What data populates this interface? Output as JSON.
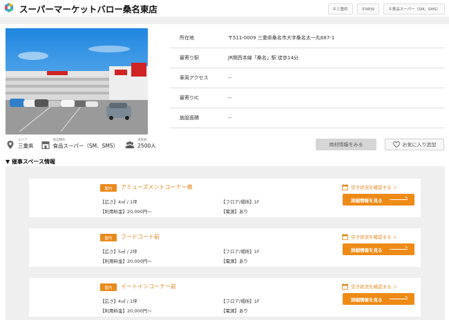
{
  "header": {
    "title": "スーパーマーケットバロー桑名東店",
    "tags": [
      "＃三重県",
      "＃NEW",
      "＃食品スーパー（SM、SMS）"
    ]
  },
  "info": [
    {
      "key": "所在地",
      "value": "〒511-0009 三重県桑名市大字桑名太一丸687-1"
    },
    {
      "key": "最寄り駅",
      "value": "JR関西本線「桑名」駅 徒歩14分"
    },
    {
      "key": "車両アクセス",
      "value": "--"
    },
    {
      "key": "最寄りIC",
      "value": "--"
    },
    {
      "key": "施設面積",
      "value": "--"
    }
  ],
  "stats": [
    {
      "label": "エリア",
      "value": "三重県",
      "icon": "location-pin-icon"
    },
    {
      "label": "施設種別",
      "value": "食品スーパー（SM、SMS）",
      "icon": "store-icon"
    },
    {
      "label": "来客数",
      "value": "2500人",
      "icon": "people-icon"
    }
  ],
  "actions": {
    "commerce": "商材情報をみる",
    "favorite": "お気に入り追加"
  },
  "section_title": "▼ 催事スペース情報",
  "events": [
    {
      "badge": "屋内",
      "name": "アミューズメントコーナー横",
      "area": "【広さ】4㎡ / 1坪",
      "fee": "【利用料金】20,000円〜",
      "floor": "【フロア/場所】1F",
      "power": "【電源】あり",
      "availability": "空き状況を確認する ＞",
      "detail": "詳細情報を見る"
    },
    {
      "badge": "屋内",
      "name": "フードコート前",
      "area": "【広さ】5㎡ / 2坪",
      "fee": "【利用料金】20,000円〜",
      "floor": "【フロア/場所】1F",
      "power": "【電源】あり",
      "availability": "空き状況を確認する ＞",
      "detail": "詳細情報を見る"
    },
    {
      "badge": "屋内",
      "name": "イートインコーナー前",
      "area": "【広さ】4㎡ / 1坪",
      "fee": "【利用料金】20,000円〜",
      "floor": "【フロア/場所】1F",
      "power": "【電源】あり",
      "availability": "空き状況を確認する ＞",
      "detail": "詳細情報を見る"
    }
  ],
  "colors": {
    "accent": "#ee8a16",
    "accent_text": "#e08418",
    "panel": "#efefef"
  }
}
